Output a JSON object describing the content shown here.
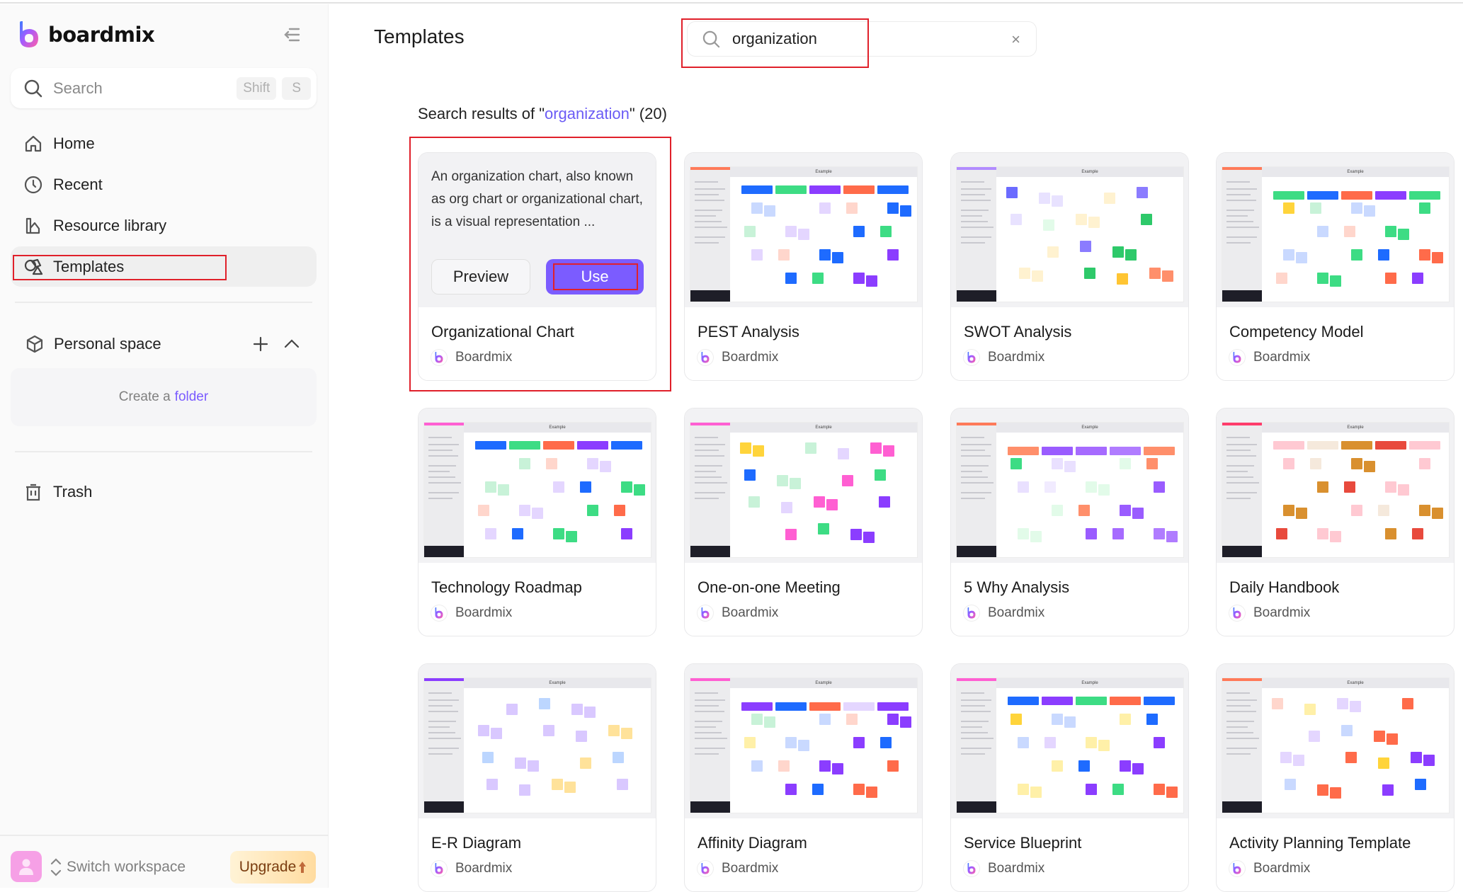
{
  "app": {
    "name": "boardmix",
    "brand_colors": {
      "accent": "#7b5cff",
      "highlight": "#e0202a",
      "upgrade_text": "#7a3d10"
    }
  },
  "sidebar": {
    "search": {
      "placeholder": "Search",
      "shortcut": [
        "Shift",
        "S"
      ]
    },
    "nav": [
      {
        "id": "home",
        "label": "Home",
        "icon": "home-icon"
      },
      {
        "id": "recent",
        "label": "Recent",
        "icon": "clock-icon"
      },
      {
        "id": "resource-library",
        "label": "Resource library",
        "icon": "library-icon"
      },
      {
        "id": "templates",
        "label": "Templates",
        "icon": "templates-icon",
        "active": true
      }
    ],
    "personal_space": {
      "label": "Personal space",
      "create_prefix": "Create a",
      "create_link": "folder"
    },
    "trash": {
      "label": "Trash"
    },
    "footer": {
      "switch_label": "Switch workspace",
      "upgrade_label": "Upgrade"
    }
  },
  "main": {
    "title": "Templates",
    "search": {
      "value": "organization",
      "clear": "×"
    },
    "results": {
      "prefix": "Search results of \"",
      "keyword": "organization",
      "suffix": "\" (20)"
    },
    "cards": [
      {
        "name": "Organizational Chart",
        "author": "Boardmix",
        "hovered": true,
        "description": "An organization chart, also known as org chart or organizational chart, is a visual representation ...",
        "preview_label": "Preview",
        "use_label": "Use",
        "palette": [
          "#7b5cff",
          "#3ddc84",
          "#ffd43b"
        ]
      },
      {
        "name": "PEST Analysis",
        "author": "Boardmix",
        "header": "Example",
        "strip": "#ff7a59",
        "palette": [
          "#1e6bff",
          "#3ddc84",
          "#8b3dff",
          "#ff6b4a",
          "#c9d9ff",
          "#c8f2d8",
          "#e4d6ff",
          "#ffd6cc"
        ]
      },
      {
        "name": "SWOT Analysis",
        "author": "Boardmix",
        "header": "Example",
        "strip": "#b28cff",
        "palette": [
          "#8b7cff",
          "#2ec96a",
          "#ffc533",
          "#ff8f6b",
          "#6b6bff",
          "#e8e2ff",
          "#e2fbe9",
          "#fff2d0"
        ]
      },
      {
        "name": "Competency Model",
        "author": "Boardmix",
        "header": "Example",
        "strip": "#ff7a59",
        "palette": [
          "#3ddc84",
          "#1e6bff",
          "#ff6b4a",
          "#8b3dff",
          "#ffd43b",
          "#c8f2d8",
          "#c9d9ff",
          "#ffd6cc"
        ]
      },
      {
        "name": "Technology Roadmap",
        "author": "Boardmix",
        "header": "Example",
        "strip": "#ff5fd2",
        "palette": [
          "#1e6bff",
          "#3ddc84",
          "#ff6b4a",
          "#8b3dff",
          "#ff5fd2",
          "#c8f2d8",
          "#ffd6cc",
          "#e4d6ff"
        ]
      },
      {
        "name": "One-on-one Meeting",
        "author": "Boardmix",
        "header": "Example",
        "strip": "#ff5fd2",
        "palette": [
          "#ff5fd2",
          "#3ddc84",
          "#8b3dff",
          "#ff6b4a",
          "#ffd43b",
          "#1e6bff",
          "#c8f2d8",
          "#e4d6ff"
        ]
      },
      {
        "name": "5 Why Analysis",
        "author": "Boardmix",
        "header": "Example",
        "strip": "#ff7a59",
        "palette": [
          "#ff8f6b",
          "#9a5cff",
          "#a66bff",
          "#b07cff",
          "#3ddc84",
          "#e9e0ff",
          "#f1ebff",
          "#e2fbe9"
        ]
      },
      {
        "name": "Daily Handbook",
        "author": "Boardmix",
        "header": "Example",
        "strip": "#ff3d6b",
        "palette": [
          "#ffc9d2",
          "#f5e9dc",
          "#d9902f",
          "#e84a3d",
          "#ffc9d2",
          "#f5e9dc",
          "#d9902f",
          "#e84a3d"
        ]
      },
      {
        "name": "E-R Diagram",
        "author": "Boardmix",
        "header": "Example",
        "strip": "#8b3dff",
        "palette": [
          "#d9c8ff",
          "#ffe29a",
          "#bcd6ff",
          "#d9c8ff",
          "#ffe29a",
          "#d9c8ff",
          "#bcd6ff",
          "#d9c8ff"
        ]
      },
      {
        "name": "Affinity Diagram",
        "author": "Boardmix",
        "header": "Example",
        "strip": "#ff5fd2",
        "palette": [
          "#8b3dff",
          "#1e6bff",
          "#ff6b4a",
          "#e4d6ff",
          "#c8f2d8",
          "#fff0a8",
          "#c9d9ff",
          "#ffd6cc"
        ]
      },
      {
        "name": "Service Blueprint",
        "author": "Boardmix",
        "header": "Example",
        "strip": "#ff5fd2",
        "palette": [
          "#1e6bff",
          "#8b3dff",
          "#3ddc84",
          "#ff6b4a",
          "#ffd43b",
          "#c9d9ff",
          "#e4d6ff",
          "#fff0a8"
        ]
      },
      {
        "name": "Activity Planning Template",
        "author": "Boardmix",
        "header": "Example",
        "strip": "#ff7a59",
        "palette": [
          "#ff6b4a",
          "#ffd43b",
          "#8b3dff",
          "#1e6bff",
          "#ffd6cc",
          "#fff0a8",
          "#e4d6ff",
          "#c9d9ff"
        ]
      }
    ]
  }
}
